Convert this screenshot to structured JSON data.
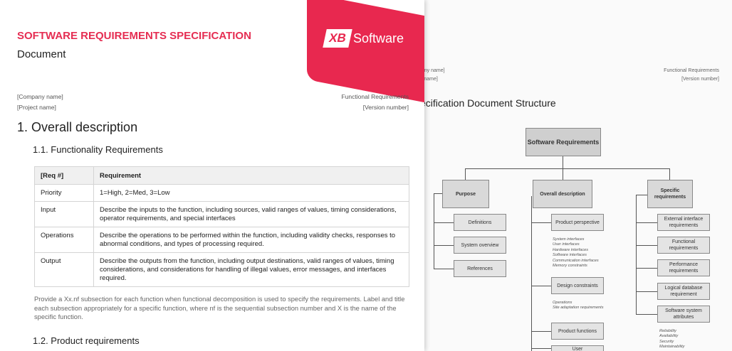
{
  "back_page": {
    "header_left": [
      "pany name]",
      "ct name]"
    ],
    "header_right": [
      "Functional Requirements",
      "[Version number]"
    ],
    "title": "ecification Document Structure",
    "diagram": {
      "root": "Software Requirements",
      "purpose": {
        "label": "Purpose",
        "children": [
          "Definitions",
          "System overview",
          "References"
        ]
      },
      "overall": {
        "label": "Overall description",
        "children": [
          "Product perspective",
          "Design constraints",
          "Product functions",
          "User"
        ],
        "notes": [
          [
            "System interfaces",
            "User interfaces",
            "Hardware interfaces",
            "Software interfaces",
            "Communication interfaces",
            "Memory constraints"
          ],
          [
            "Operations",
            "Site adaptation requirements"
          ]
        ]
      },
      "specific": {
        "label": "Specific requirements",
        "children": [
          "External interface requirements",
          "Functional requirements",
          "Performance requirements",
          "Logical database requirement",
          "Software system attributes"
        ],
        "notes": [
          "Reliability",
          "Availability",
          "Security",
          "Maintainability"
        ]
      }
    }
  },
  "front_page": {
    "spec_title": "SOFTWARE REQUIREMENTS SPECIFICATION",
    "doc_label": "Document",
    "logo": {
      "mark": "XB",
      "text": "Software",
      "color": "#e8284f"
    },
    "header_left": [
      "[Company name]",
      "[Project name]"
    ],
    "header_right": [
      "Functional Requirements",
      "[Version number]"
    ],
    "section_title": "1. Overall description",
    "subsection_1": "1.1. Functionality Requirements",
    "table": {
      "headers": [
        "[Req #]",
        "Requirement"
      ],
      "rows": [
        [
          "Priority",
          "1=High, 2=Med, 3=Low"
        ],
        [
          "Input",
          "Describe the inputs to the function, including sources, valid ranges of values, timing considerations, operator requirements, and special interfaces"
        ],
        [
          "Operations",
          "Describe the operations to be performed within the function, including validity checks, responses to abnormal conditions, and types of processing required."
        ],
        [
          "Output",
          "Describe the outputs from the function, including output destinations, valid ranges of values, timing considerations, and considerations for handling of illegal values, error messages, and interfaces required."
        ]
      ]
    },
    "paragraph": "Provide a Xx.nf subsection for each function when functional decomposition is used to specify the requirements. Label and title each subsection appropriately for a specific function, where nf is the sequential subsection number and X is the name of the specific function.",
    "subsection_2": "1.2. Product requirements"
  }
}
